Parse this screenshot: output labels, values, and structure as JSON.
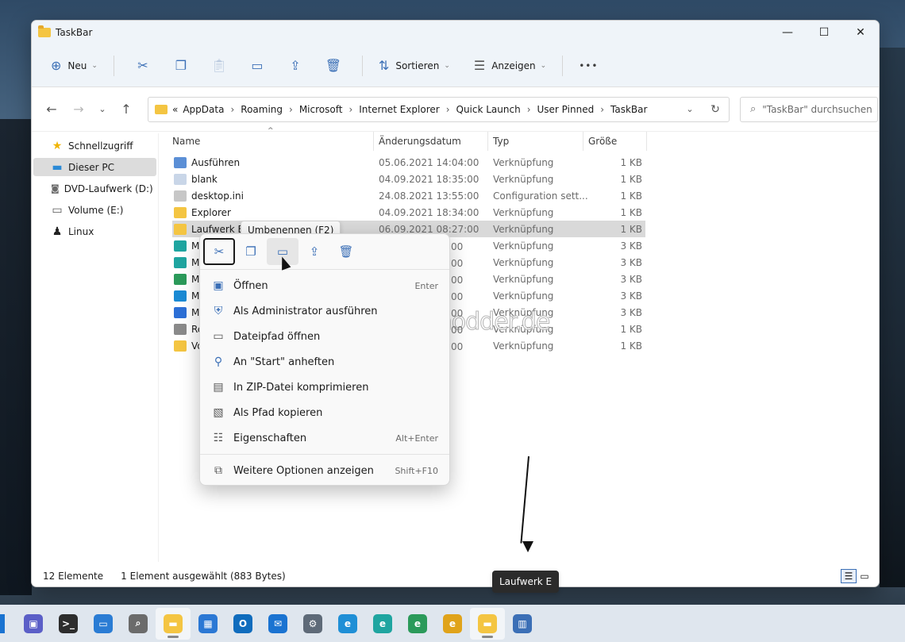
{
  "window": {
    "title": "TaskBar",
    "controls": {
      "minimize": "—",
      "maximize": "☐",
      "close": "✕"
    }
  },
  "toolbar": {
    "new_label": "Neu",
    "sort_label": "Sortieren",
    "view_label": "Anzeigen",
    "more": "•••"
  },
  "breadcrumb": {
    "overflow": "«",
    "items": [
      "AppData",
      "Roaming",
      "Microsoft",
      "Internet Explorer",
      "Quick Launch",
      "User Pinned",
      "TaskBar"
    ]
  },
  "search": {
    "placeholder": "\"TaskBar\" durchsuchen"
  },
  "sidebar": {
    "items": [
      {
        "label": "Schnellzugriff",
        "icon": "star-icon"
      },
      {
        "label": "Dieser PC",
        "icon": "pc-icon",
        "selected": true
      },
      {
        "label": "DVD-Laufwerk (D:) C",
        "icon": "dvd-icon"
      },
      {
        "label": "Volume (E:)",
        "icon": "drive-icon"
      },
      {
        "label": "Linux",
        "icon": "penguin-icon"
      }
    ]
  },
  "columns": {
    "name": "Name",
    "date": "Änderungsdatum",
    "type": "Typ",
    "size": "Größe"
  },
  "files": [
    {
      "name": "Ausführen",
      "date": "05.06.2021 14:04:00",
      "type": "Verknüpfung",
      "size": "1 KB",
      "color": "#5b8fd6"
    },
    {
      "name": "blank",
      "date": "04.09.2021 18:35:00",
      "type": "Verknüpfung",
      "size": "1 KB",
      "color": "#c9d6e8"
    },
    {
      "name": "desktop.ini",
      "date": "24.08.2021 13:55:00",
      "type": "Configuration sett...",
      "size": "1 KB",
      "color": "#c7c7c7"
    },
    {
      "name": "Explorer",
      "date": "04.09.2021 18:34:00",
      "type": "Verknüpfung",
      "size": "1 KB",
      "color": "#f4c542"
    },
    {
      "name": "Laufwerk E",
      "date": "06.09.2021 08:27:00",
      "type": "Verknüpfung",
      "size": "1 KB",
      "color": "#f4c542",
      "selected": true
    },
    {
      "name": "Mi",
      "date": "",
      "type": "Verknüpfung",
      "size": "3 KB",
      "color": "#1fa5a0"
    },
    {
      "name": "Mi",
      "date": "",
      "type": "Verknüpfung",
      "size": "3 KB",
      "color": "#1fa5a0"
    },
    {
      "name": "Mi",
      "date": "",
      "type": "Verknüpfung",
      "size": "3 KB",
      "color": "#2b9a5a"
    },
    {
      "name": "Mi",
      "date": "",
      "type": "Verknüpfung",
      "size": "3 KB",
      "color": "#1a8ad4"
    },
    {
      "name": "Mi",
      "date": "",
      "type": "Verknüpfung",
      "size": "3 KB",
      "color": "#2c6fd6"
    },
    {
      "name": "Re",
      "date": "",
      "type": "Verknüpfung",
      "size": "1 KB",
      "color": "#8a8a8a"
    },
    {
      "name": "Vo",
      "date": "",
      "type": "Verknüpfung",
      "size": "1 KB",
      "color": "#f4c542"
    }
  ],
  "date_fragments": [
    "00",
    "00",
    "00",
    "00",
    "00",
    "00",
    "00"
  ],
  "status": {
    "count": "12 Elemente",
    "selection": "1 Element ausgewählt (883 Bytes)"
  },
  "tooltip_rename": "Umbenennen (F2)",
  "context_menu": {
    "items": [
      {
        "label": "Öffnen",
        "accel": "Enter",
        "icon": "open-icon"
      },
      {
        "label": "Als Administrator ausführen",
        "accel": "",
        "icon": "shield-icon"
      },
      {
        "label": "Dateipfad öffnen",
        "accel": "",
        "icon": "folder-icon"
      },
      {
        "label": "An \"Start\" anheften",
        "accel": "",
        "icon": "pin-icon"
      },
      {
        "label": "In ZIP-Datei komprimieren",
        "accel": "",
        "icon": "zip-icon"
      },
      {
        "label": "Als Pfad kopieren",
        "accel": "",
        "icon": "path-icon"
      },
      {
        "label": "Eigenschaften",
        "accel": "Alt+Enter",
        "icon": "properties-icon"
      }
    ],
    "more": {
      "label": "Weitere Optionen anzeigen",
      "accel": "Shift+F10",
      "icon": "more-options-icon"
    }
  },
  "watermark": "Deskmodder.de",
  "taskbar_tooltip": "Laufwerk E",
  "taskbar": [
    {
      "name": "chat-icon",
      "color": "#5b5fc7",
      "glyph": "▣"
    },
    {
      "name": "terminal-icon",
      "color": "#2d2d2d",
      "glyph": ">_"
    },
    {
      "name": "screenshot-icon",
      "color": "#2a7cd4",
      "glyph": "▭"
    },
    {
      "name": "search-icon",
      "color": "#6b6b6b",
      "glyph": "⌕"
    },
    {
      "name": "file-explorer-icon",
      "color": "#f4c542",
      "glyph": "▬",
      "active": true
    },
    {
      "name": "store-icon",
      "color": "#2b78d4",
      "glyph": "▦"
    },
    {
      "name": "outlook-icon",
      "color": "#0f6cbd",
      "glyph": "O"
    },
    {
      "name": "mail-icon",
      "color": "#1a73d1",
      "glyph": "✉"
    },
    {
      "name": "settings-icon",
      "color": "#5e6a78",
      "glyph": "⚙"
    },
    {
      "name": "edge-icon",
      "color": "#1f8fd6",
      "glyph": "e"
    },
    {
      "name": "edge-beta-icon",
      "color": "#1fa5a0",
      "glyph": "e"
    },
    {
      "name": "edge-dev-icon",
      "color": "#2b9a5a",
      "glyph": "e"
    },
    {
      "name": "edge-canary-icon",
      "color": "#e0a31a",
      "glyph": "e"
    },
    {
      "name": "laufwerk-e-icon",
      "color": "#f4c542",
      "glyph": "▬",
      "active": true
    },
    {
      "name": "resource-monitor-icon",
      "color": "#3b6fb6",
      "glyph": "▥"
    }
  ]
}
